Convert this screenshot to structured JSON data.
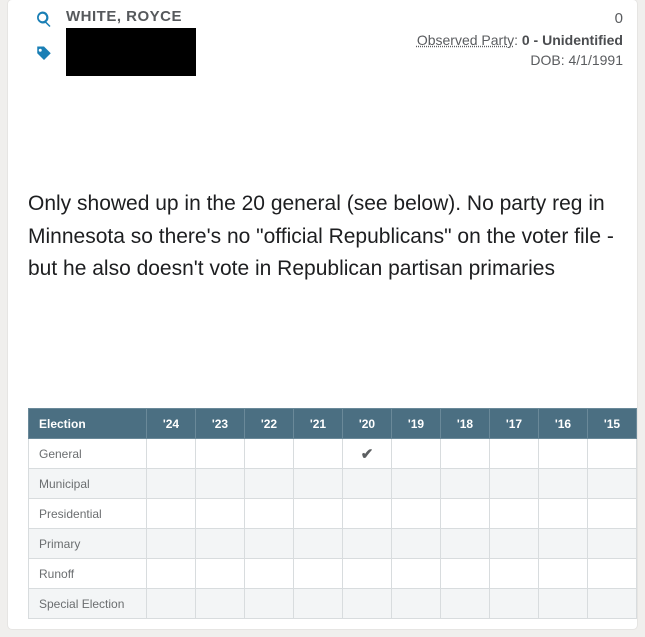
{
  "record": {
    "name": "WHITE, ROYCE",
    "right_zero": "0",
    "observed_party_label": "Observed Party",
    "observed_party_value": "0 - Unidentified",
    "dob_label": "DOB:",
    "dob_value": "4/1/1991"
  },
  "commentary": "Only showed up in the 20 general (see below). No party reg in Minnesota so there's no \"official Republicans\" on the voter file - but he also doesn't vote in Republican partisan primaries",
  "table": {
    "header_label": "Election",
    "years": [
      "'24",
      "'23",
      "'22",
      "'21",
      "'20",
      "'19",
      "'18",
      "'17",
      "'16",
      "'15"
    ],
    "rows": [
      {
        "label": "General",
        "marks": [
          "",
          "",
          "",
          "",
          "✓",
          "",
          "",
          "",
          "",
          ""
        ]
      },
      {
        "label": "Municipal",
        "marks": [
          "",
          "",
          "",
          "",
          "",
          "",
          "",
          "",
          "",
          ""
        ]
      },
      {
        "label": "Presidential",
        "marks": [
          "",
          "",
          "",
          "",
          "",
          "",
          "",
          "",
          "",
          ""
        ]
      },
      {
        "label": "Primary",
        "marks": [
          "",
          "",
          "",
          "",
          "",
          "",
          "",
          "",
          "",
          ""
        ]
      },
      {
        "label": "Runoff",
        "marks": [
          "",
          "",
          "",
          "",
          "",
          "",
          "",
          "",
          "",
          ""
        ]
      },
      {
        "label": "Special Election",
        "marks": [
          "",
          "",
          "",
          "",
          "",
          "",
          "",
          "",
          "",
          ""
        ]
      }
    ]
  },
  "icons": {
    "search": "search-icon",
    "tag": "tag-icon"
  }
}
